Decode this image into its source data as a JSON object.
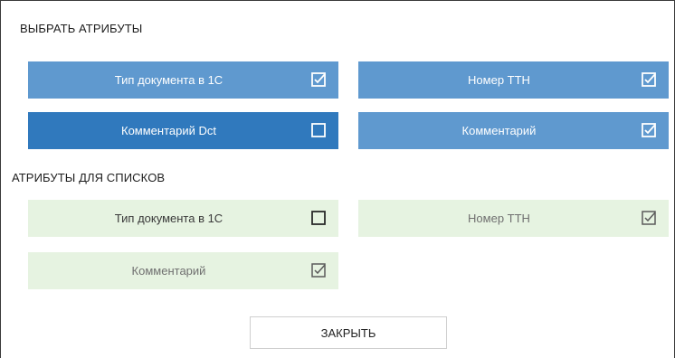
{
  "dialog": {
    "select_section_title": "ВЫБРАТЬ АТРИБУТЫ",
    "list_section_title": "АТРИБУТЫ ДЛЯ СПИСКОВ",
    "close_label": "ЗАКРЫТЬ"
  },
  "select_attributes": [
    {
      "label": "Тип документа в 1С",
      "checked": true
    },
    {
      "label": "Номер ТТН",
      "checked": true
    },
    {
      "label": "Комментарий Dct",
      "checked": false
    },
    {
      "label": "Комментарий",
      "checked": true
    }
  ],
  "list_attributes": [
    {
      "label": "Тип документа в 1С",
      "checked": false
    },
    {
      "label": "Номер ТТН",
      "checked": true
    },
    {
      "label": "Комментарий",
      "checked": true
    }
  ],
  "colors": {
    "tile_blue": "#5f99cf",
    "tile_blue_active": "#3079bd",
    "tile_green": "#e6f3e1"
  }
}
